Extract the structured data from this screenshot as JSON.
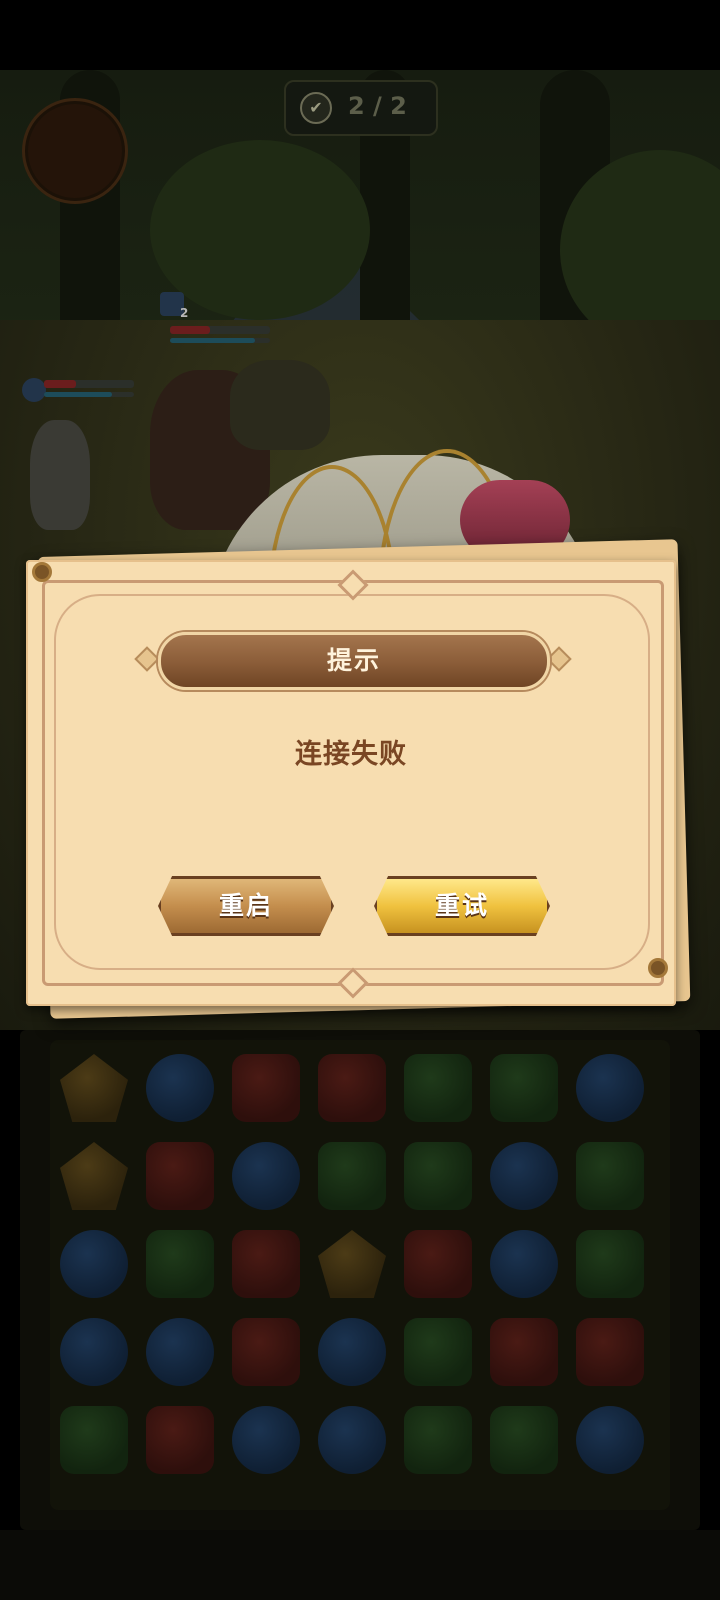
{
  "hud": {
    "wave_progress": "2 / 2",
    "hero_level": "2"
  },
  "dialog": {
    "title": "提示",
    "message": "连接失败",
    "buttons": {
      "restart_label": "重启",
      "retry_label": "重试"
    }
  },
  "colors": {
    "dialog_paper": "#f7ddb0",
    "title_bar": "#8a5c38",
    "message_text": "#7a4623",
    "restart_button": "#c48e4d",
    "retry_button": "#f0c23f"
  },
  "board": {
    "rows": [
      [
        "yellow",
        "blue",
        "red",
        "red",
        "green",
        "green",
        "blue"
      ],
      [
        "yellow",
        "red",
        "blue",
        "green",
        "green",
        "blue",
        "green"
      ],
      [
        "blue",
        "green",
        "red",
        "yellow",
        "red",
        "blue",
        "green"
      ],
      [
        "blue",
        "blue",
        "red",
        "blue",
        "green",
        "red",
        "red"
      ],
      [
        "green",
        "red",
        "blue",
        "blue",
        "green",
        "green",
        "blue"
      ]
    ]
  }
}
